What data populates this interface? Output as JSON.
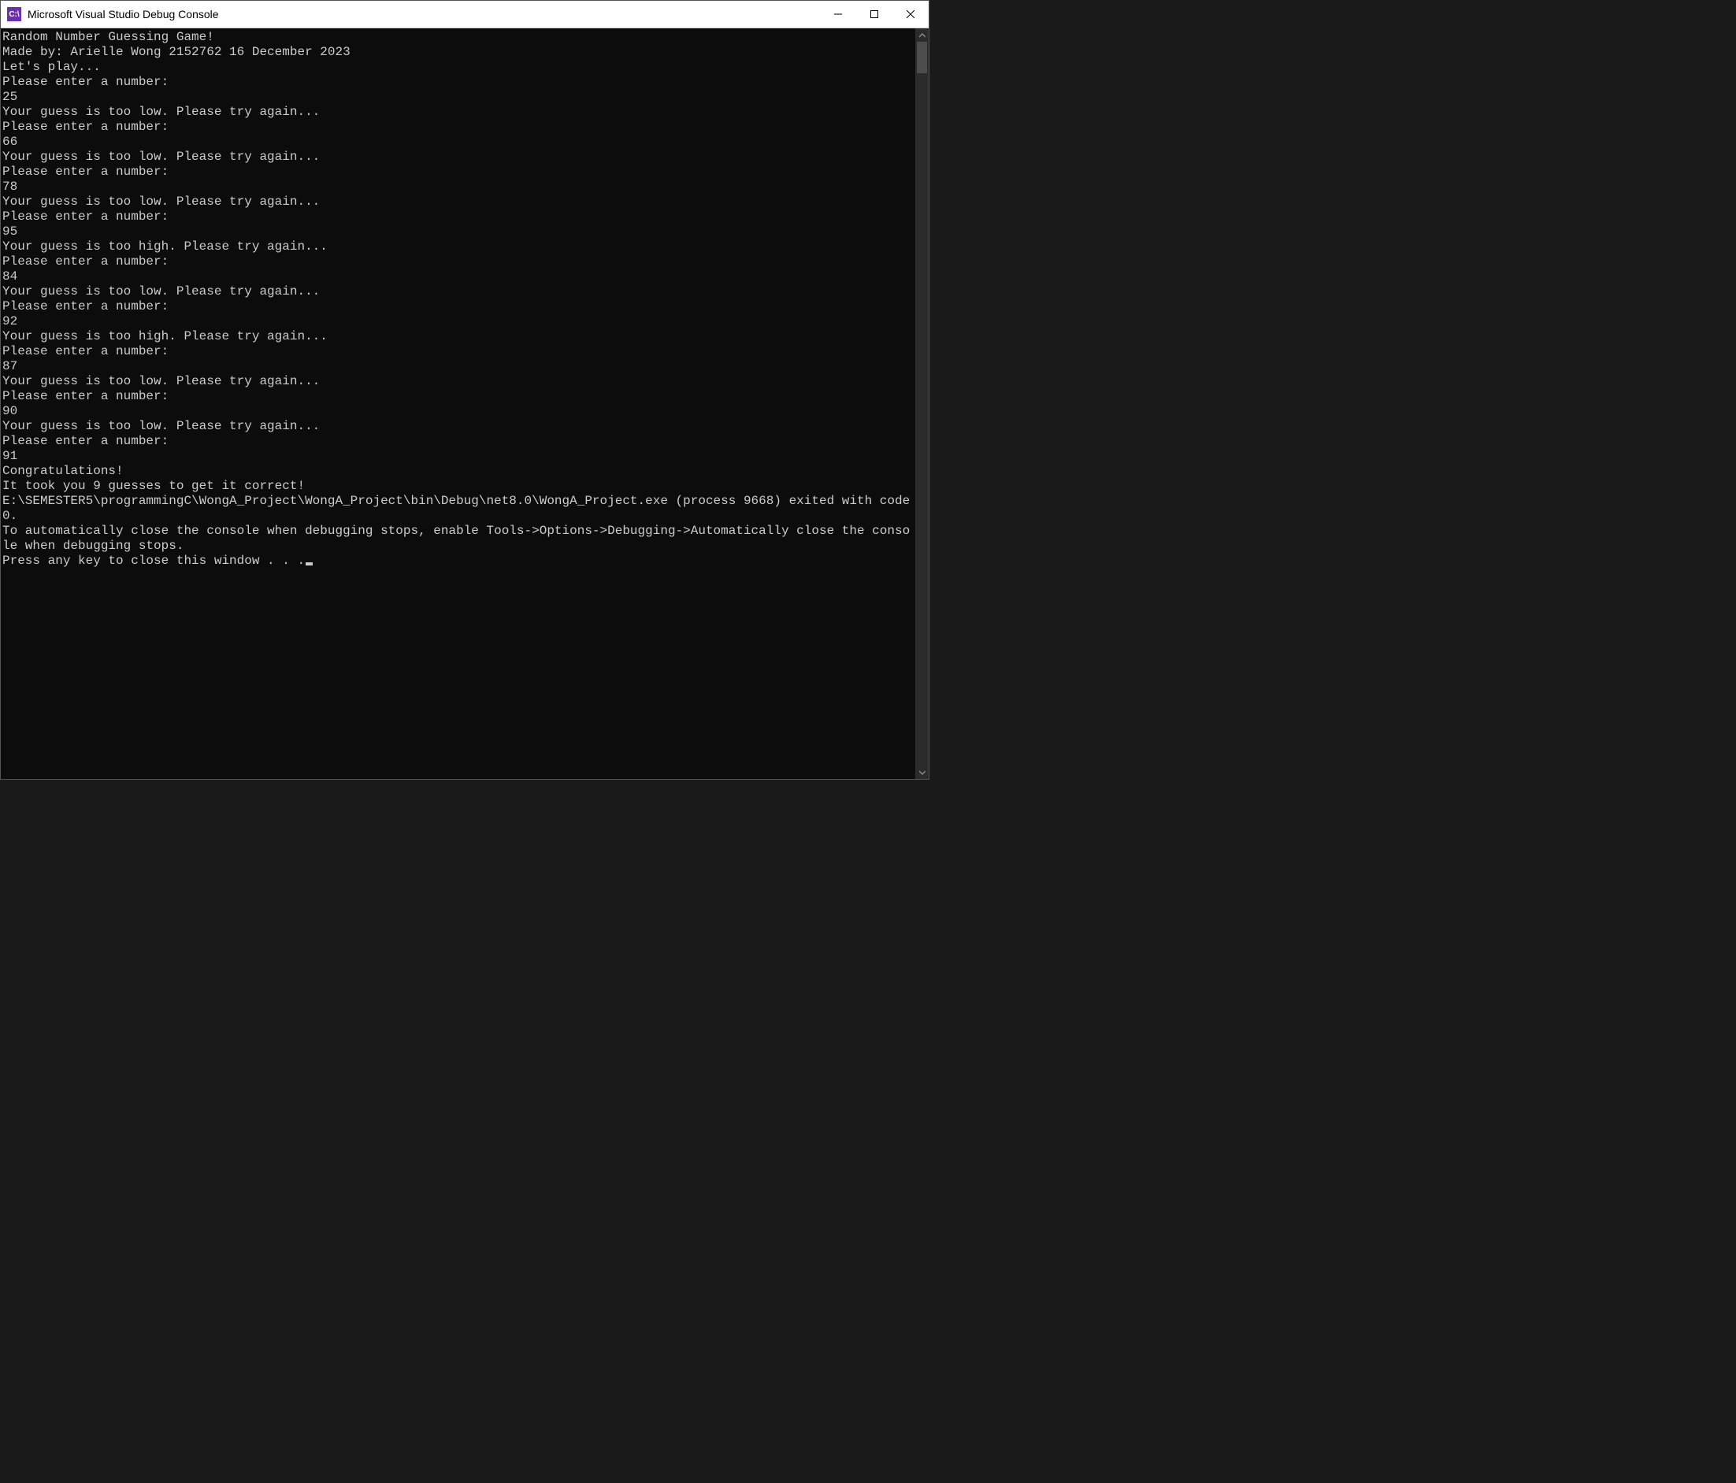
{
  "window": {
    "title": "Microsoft Visual Studio Debug Console",
    "app_icon_text": "C:\\"
  },
  "console": {
    "lines": [
      "Random Number Guessing Game!",
      "Made by: Arielle Wong 2152762 16 December 2023",
      "",
      "",
      "Let's play...",
      "Please enter a number:",
      "25",
      "Your guess is too low. Please try again...",
      "Please enter a number:",
      "66",
      "Your guess is too low. Please try again...",
      "Please enter a number:",
      "78",
      "Your guess is too low. Please try again...",
      "Please enter a number:",
      "95",
      "Your guess is too high. Please try again...",
      "Please enter a number:",
      "84",
      "Your guess is too low. Please try again...",
      "Please enter a number:",
      "92",
      "Your guess is too high. Please try again...",
      "Please enter a number:",
      "87",
      "Your guess is too low. Please try again...",
      "Please enter a number:",
      "90",
      "Your guess is too low. Please try again...",
      "Please enter a number:",
      "91",
      "Congratulations!",
      "It took you 9 guesses to get it correct!",
      "",
      "E:\\SEMESTER5\\programmingC\\WongA_Project\\WongA_Project\\bin\\Debug\\net8.0\\WongA_Project.exe (process 9668) exited with code 0.",
      "To automatically close the console when debugging stops, enable Tools->Options->Debugging->Automatically close the console when debugging stops."
    ],
    "last_line": "Press any key to close this window . . ."
  }
}
